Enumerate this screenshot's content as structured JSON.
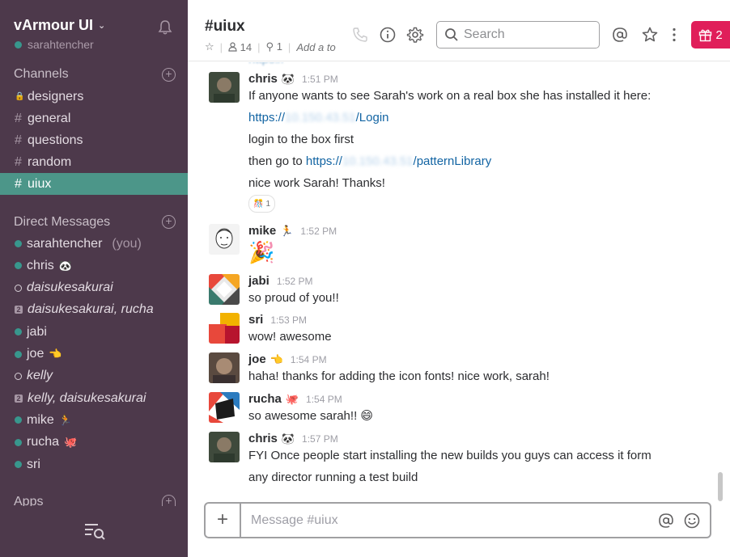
{
  "team": {
    "name": "vArmour UI",
    "user": "sarahtencher"
  },
  "sidebar": {
    "channels_header": "Channels",
    "channels": [
      {
        "label": "designers",
        "private": true
      },
      {
        "label": "general"
      },
      {
        "label": "questions"
      },
      {
        "label": "random"
      },
      {
        "label": "uiux",
        "active": true
      }
    ],
    "dm_header": "Direct Messages",
    "dms": [
      {
        "label": "sarahtencher",
        "suffix": "(you)",
        "status": "online"
      },
      {
        "label": "chris",
        "emoji": "🐼",
        "status": "online"
      },
      {
        "label": "daisukesakurai",
        "status": "away"
      },
      {
        "label": "daisukesakurai, rucha",
        "status": "group",
        "count": "2"
      },
      {
        "label": "jabi",
        "status": "online"
      },
      {
        "label": "joe",
        "emoji": "👈",
        "status": "online"
      },
      {
        "label": "kelly",
        "status": "away"
      },
      {
        "label": "kelly, daisukesakurai",
        "status": "group",
        "count": "2"
      },
      {
        "label": "mike",
        "emoji": "🏃",
        "status": "online"
      },
      {
        "label": "rucha",
        "emoji": "🐙",
        "status": "online"
      },
      {
        "label": "sri",
        "status": "online"
      }
    ],
    "apps_header": "Apps"
  },
  "header": {
    "channel": "#uiux",
    "members": "14",
    "pins": "1",
    "add_topic": "Add a to",
    "search_placeholder": "Search",
    "gift_count": "2"
  },
  "messages": [
    {
      "author": "chris",
      "emoji": "🐼",
      "time": "1:51 PM",
      "avatar": "chris",
      "lines": [
        {
          "text": "If anyone wants to see Sarah's work on a real box she has installed it here:"
        },
        {
          "link_pre": "https://",
          "link_blur": "10.150.43.51",
          "link_post": "/Login"
        },
        {
          "text": "login to the box first"
        },
        {
          "text_pre": "then go to ",
          "link_pre": "https://",
          "link_blur": "10.150.43.51",
          "link_post": "/patternLibrary"
        },
        {
          "text": "nice work Sarah!  Thanks!"
        }
      ],
      "reaction": {
        "emoji": "🎊",
        "count": "1"
      }
    },
    {
      "author": "mike",
      "emoji": "🏃",
      "time": "1:52 PM",
      "avatar": "mike",
      "lines": [
        {
          "text": "🎉"
        }
      ]
    },
    {
      "author": "jabi",
      "time": "1:52 PM",
      "avatar": "jabi",
      "lines": [
        {
          "text": "so proud of you!!"
        }
      ]
    },
    {
      "author": "sri",
      "time": "1:53 PM",
      "avatar": "sri",
      "lines": [
        {
          "text": "wow! awesome"
        }
      ]
    },
    {
      "author": "joe",
      "emoji": "👈",
      "time": "1:54 PM",
      "avatar": "joe",
      "lines": [
        {
          "text": "haha! thanks for adding the icon fonts!  nice work, sarah!"
        }
      ]
    },
    {
      "author": "rucha",
      "emoji": "🐙",
      "time": "1:54 PM",
      "avatar": "rucha",
      "lines": [
        {
          "text": "so awesome sarah!! 😄"
        }
      ]
    },
    {
      "author": "chris",
      "emoji": "🐼",
      "time": "1:57 PM",
      "avatar": "chris",
      "lines": [
        {
          "text": "FYI Once people start installing the new builds you guys can access it form"
        },
        {
          "text": "any director running a test build"
        }
      ]
    }
  ],
  "composer": {
    "placeholder": "Message #uiux"
  },
  "colors": {
    "sidebar": "#4d394b",
    "active": "#4c9689",
    "link": "#1264a3",
    "gift": "#e01e5a"
  }
}
